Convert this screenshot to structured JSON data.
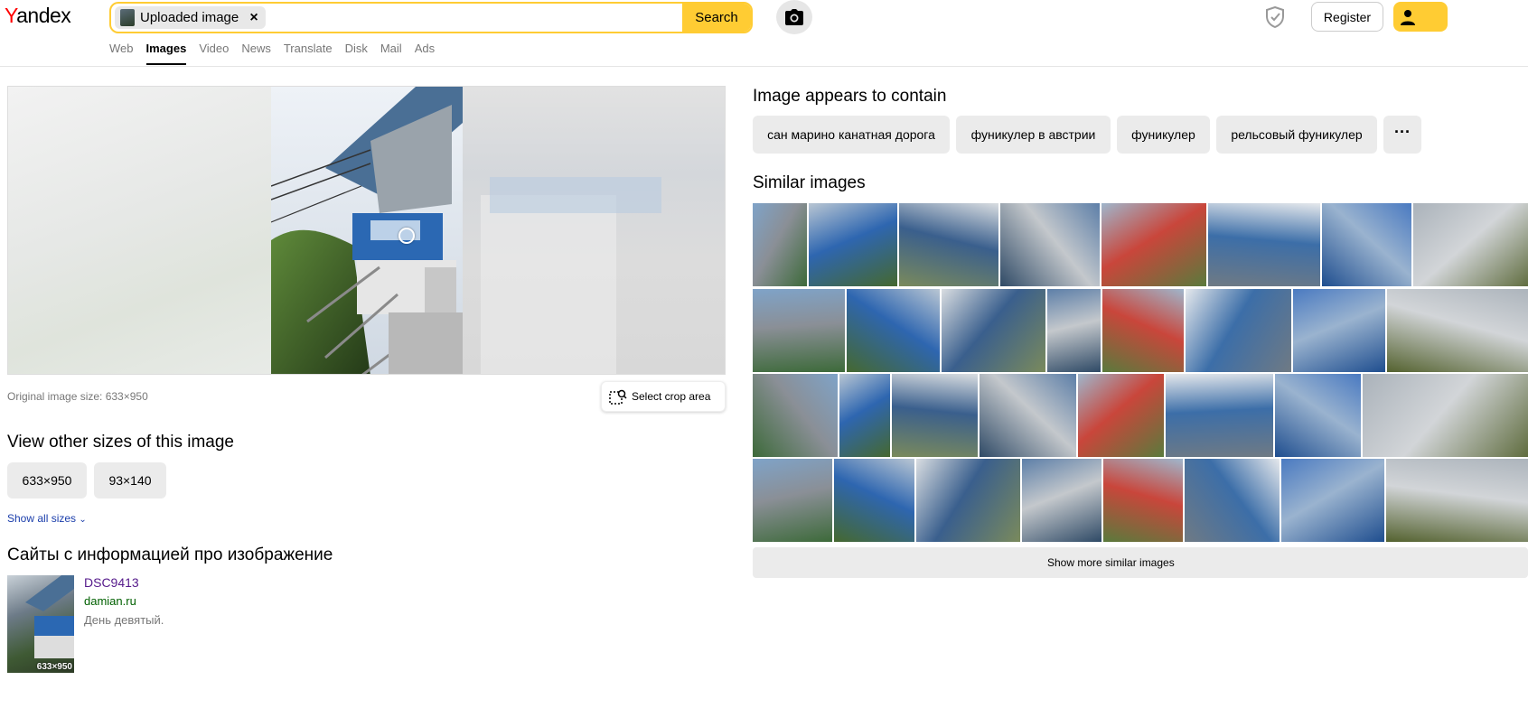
{
  "header": {
    "logo": "Yandex",
    "search_chip": "Uploaded image",
    "search_button": "Search",
    "register_button": "Register"
  },
  "nav": {
    "tabs": [
      "Web",
      "Images",
      "Video",
      "News",
      "Translate",
      "Disk",
      "Mail",
      "Ads"
    ],
    "active": "Images"
  },
  "viewer": {
    "original_size": "Original image size: 633×950",
    "crop_button": "Select crop area"
  },
  "sizes": {
    "title": "View other sizes of this image",
    "items": [
      "633×950",
      "93×140"
    ],
    "show_all": "Show all sizes"
  },
  "sites": {
    "title": "Сайты с информацией про изображение",
    "items": [
      {
        "title": "DSC9413",
        "domain": "damian.ru",
        "desc": "День девятый.",
        "thumb_label": "633×950"
      }
    ]
  },
  "tags": {
    "title": "Image appears to contain",
    "items": [
      "сан марино канатная дорога",
      "фуникулер в австрии",
      "фуникулер",
      "рельсовый фуникулер"
    ]
  },
  "similar": {
    "title": "Similar images",
    "more_button": "Show more similar images"
  },
  "colors": {
    "accent": "#ffcc33",
    "link": "#1a3dab",
    "visited": "#551a8b",
    "domain": "#006000"
  }
}
